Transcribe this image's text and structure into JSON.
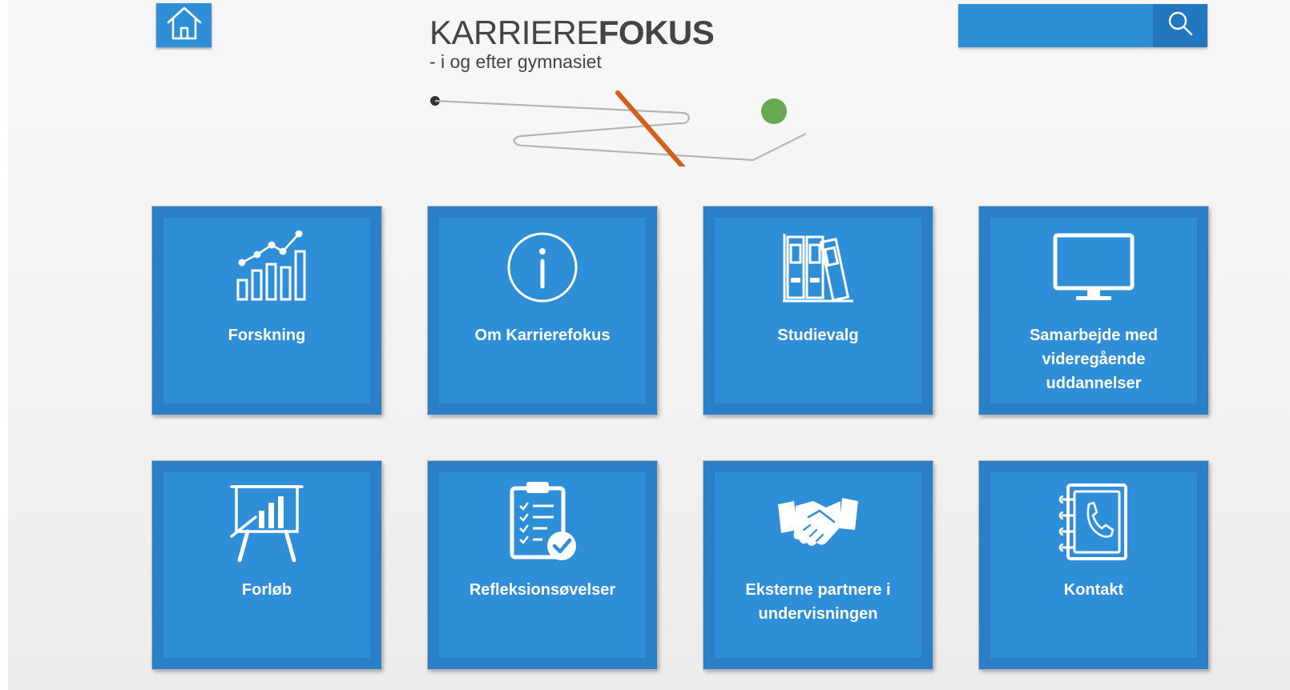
{
  "header": {
    "home_icon": "home-icon",
    "search": {
      "value": "",
      "placeholder": "",
      "icon": "search-icon"
    },
    "logo": {
      "title_light": "KARRIERE",
      "title_bold": "FOKUS",
      "tagline": "- i og efter gymnasiet"
    }
  },
  "tiles": [
    {
      "label": "Forskning",
      "icon": "growth-chart-icon"
    },
    {
      "label": "Om Karrierefokus",
      "icon": "info-icon"
    },
    {
      "label": "Studievalg",
      "icon": "binders-icon"
    },
    {
      "label": "Samarbejde med videregående uddannelser",
      "icon": "monitor-icon"
    },
    {
      "label": "Forløb",
      "icon": "presentation-board-icon"
    },
    {
      "label": "Refleksionsøvelser",
      "icon": "checklist-clipboard-icon"
    },
    {
      "label": "Eksterne partnere i undervisningen",
      "icon": "handshake-icon"
    },
    {
      "label": "Kontakt",
      "icon": "address-book-phone-icon"
    }
  ],
  "colors": {
    "tile_fill": "#2e8fd8",
    "tile_border": "#2a7fc6",
    "search_button": "#2277bf",
    "logo_orange": "#d45f1c",
    "logo_green": "#6aa84f",
    "text_dark": "#444444"
  }
}
